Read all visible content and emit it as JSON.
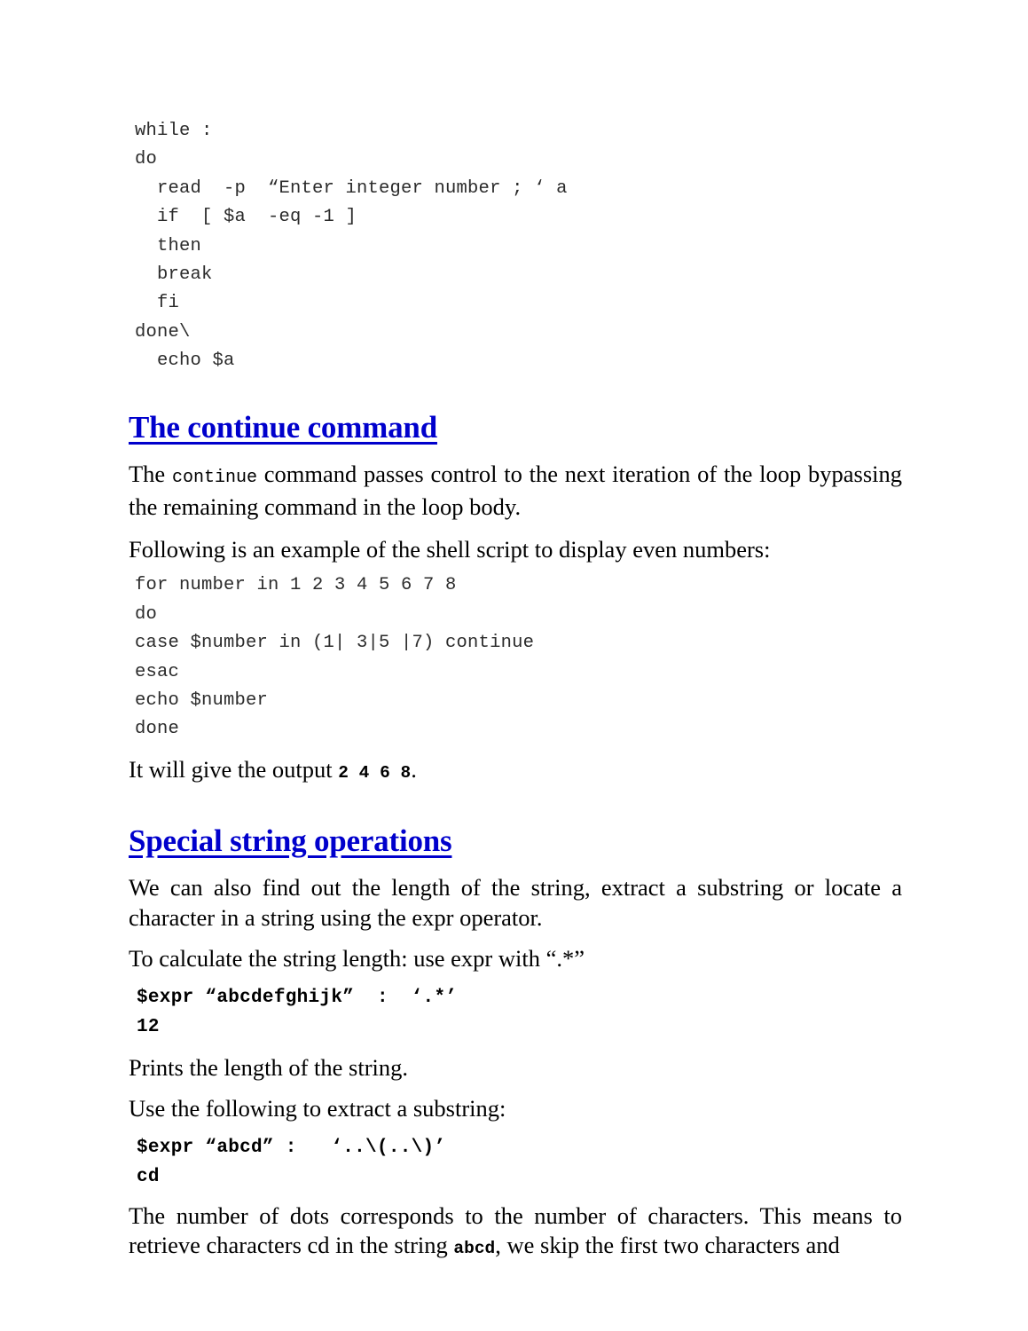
{
  "document": {
    "page_background": "#ffffff",
    "heading_color": "#0000cc",
    "body_text_color": "#000000"
  },
  "code_block_while": {
    "lines": [
      "while :",
      "do",
      "  read  -p  “Enter integer number ; ‘ a",
      "  if  [ $a  -eq -1 ]",
      "  then",
      "  break",
      "  fi",
      "done\\",
      "  echo $a"
    ],
    "text": "while :\ndo\n  read  -p  “Enter integer number ; ‘ a\n  if  [ $a  -eq -1 ]\n  then\n  break\n  fi\ndone\\\n  echo $a"
  },
  "section_continue": {
    "heading": "The continue command",
    "paragraph_1_prefix": "The ",
    "paragraph_1_code": "continue",
    "paragraph_1_suffix": " command passes control to the next iteration of the loop bypassing the remaining command in the loop body.",
    "paragraph_2": "Following is an example of the shell script to display even numbers:",
    "code_block": {
      "lines": [
        "for number in 1 2 3 4 5 6 7 8",
        "do",
        "case $number in (1| 3|5 |7) continue",
        "esac",
        "echo $number",
        "done"
      ],
      "text": "for number in 1 2 3 4 5 6 7 8\ndo\ncase $number in (1| 3|5 |7) continue\nesac\necho $number\ndone"
    },
    "output_line_prefix": "It will give the output ",
    "output_values": "2   4   6   8",
    "output_line_suffix": "."
  },
  "section_special_strings": {
    "heading": "Special string operations",
    "paragraph_1": "We can also find out the length of the string, extract a substring or locate a character in a string using the expr operator.",
    "paragraph_2": "To calculate the string length: use expr with “.*”",
    "expr_length_command": "$expr “abcdefghijk”  :  ‘.*’",
    "expr_length_result": "12",
    "paragraph_3": "Prints the length of the string.",
    "paragraph_4": "Use the following to extract a substring:",
    "expr_substring_command": "$expr “abcd” :   ‘..\\(..\\)’",
    "expr_substring_result": "cd",
    "paragraph_5_part1": "The number of dots corresponds to the number of characters. This means to retrieve characters cd in the string ",
    "paragraph_5_code": "abcd",
    "paragraph_5_part2": ", we skip the first two characters and"
  }
}
